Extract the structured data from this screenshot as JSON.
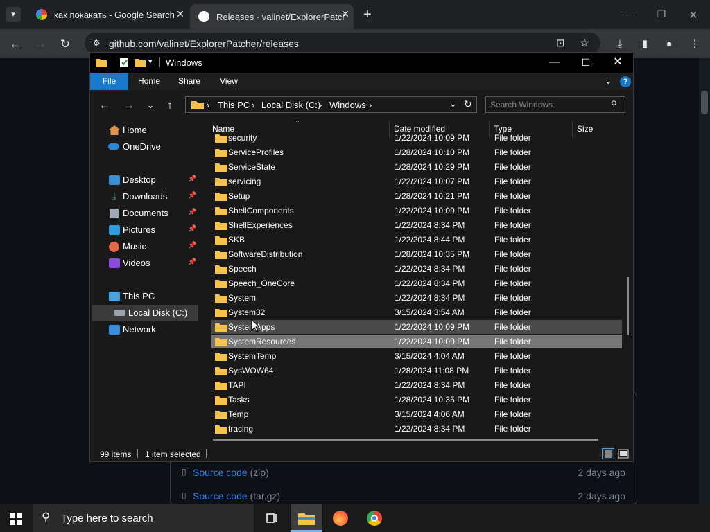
{
  "browser": {
    "tabs": [
      {
        "title": "как покакать - Google Search",
        "active": false
      },
      {
        "title": "Releases · valinet/ExplorerPatcher",
        "active": true
      }
    ],
    "url": "github.com/valinet/ExplorerPatcher/releases"
  },
  "github": {
    "assets": [
      {
        "name": "Source code",
        "ext": "(zip)",
        "time": "2 days ago"
      },
      {
        "name": "Source code",
        "ext": "(tar.gz)",
        "time": "2 days ago"
      }
    ]
  },
  "explorer": {
    "title": "Windows",
    "ribbon_tabs": [
      "File",
      "Home",
      "Share",
      "View"
    ],
    "breadcrumb": [
      "This PC",
      "Local Disk (C:)",
      "Windows"
    ],
    "search_placeholder": "Search Windows",
    "columns": [
      "Name",
      "Date modified",
      "Type",
      "Size"
    ],
    "nav": {
      "home": "Home",
      "onedrive": "OneDrive",
      "quick_access": [
        {
          "label": "Desktop",
          "pinned": true,
          "color": "#3b8fd6"
        },
        {
          "label": "Downloads",
          "pinned": true,
          "color": "#4aa36b"
        },
        {
          "label": "Documents",
          "pinned": true,
          "color": "#a0a8b8"
        },
        {
          "label": "Pictures",
          "pinned": true,
          "color": "#2f9be0"
        },
        {
          "label": "Music",
          "pinned": true,
          "color": "#e26a4a"
        },
        {
          "label": "Videos",
          "pinned": true,
          "color": "#8a4fd6"
        }
      ],
      "this_pc": "This PC",
      "local_disk": "Local Disk (C:)",
      "network": "Network"
    },
    "files": [
      {
        "name": "security",
        "date": "1/22/2024 10:09 PM",
        "type": "File folder"
      },
      {
        "name": "ServiceProfiles",
        "date": "1/28/2024 10:10 PM",
        "type": "File folder"
      },
      {
        "name": "ServiceState",
        "date": "1/28/2024 10:29 PM",
        "type": "File folder"
      },
      {
        "name": "servicing",
        "date": "1/22/2024 10:07 PM",
        "type": "File folder"
      },
      {
        "name": "Setup",
        "date": "1/28/2024 10:21 PM",
        "type": "File folder"
      },
      {
        "name": "ShellComponents",
        "date": "1/22/2024 10:09 PM",
        "type": "File folder"
      },
      {
        "name": "ShellExperiences",
        "date": "1/22/2024 8:34 PM",
        "type": "File folder"
      },
      {
        "name": "SKB",
        "date": "1/22/2024 8:44 PM",
        "type": "File folder"
      },
      {
        "name": "SoftwareDistribution",
        "date": "1/28/2024 10:35 PM",
        "type": "File folder"
      },
      {
        "name": "Speech",
        "date": "1/22/2024 8:34 PM",
        "type": "File folder"
      },
      {
        "name": "Speech_OneCore",
        "date": "1/22/2024 8:34 PM",
        "type": "File folder"
      },
      {
        "name": "System",
        "date": "1/22/2024 8:34 PM",
        "type": "File folder"
      },
      {
        "name": "System32",
        "date": "3/15/2024 3:54 AM",
        "type": "File folder"
      },
      {
        "name": "SystemApps",
        "date": "1/22/2024 10:09 PM",
        "type": "File folder",
        "state": "hover"
      },
      {
        "name": "SystemResources",
        "date": "1/22/2024 10:09 PM",
        "type": "File folder",
        "state": "selected"
      },
      {
        "name": "SystemTemp",
        "date": "3/15/2024 4:04 AM",
        "type": "File folder"
      },
      {
        "name": "SysWOW64",
        "date": "1/28/2024 11:08 PM",
        "type": "File folder"
      },
      {
        "name": "TAPI",
        "date": "1/22/2024 8:34 PM",
        "type": "File folder"
      },
      {
        "name": "Tasks",
        "date": "1/28/2024 10:35 PM",
        "type": "File folder"
      },
      {
        "name": "Temp",
        "date": "3/15/2024 4:06 AM",
        "type": "File folder"
      },
      {
        "name": "tracing",
        "date": "1/22/2024 8:34 PM",
        "type": "File folder"
      }
    ],
    "status": {
      "items": "99 items",
      "selected": "1 item selected"
    }
  },
  "taskbar": {
    "search_placeholder": "Type here to search"
  },
  "colors": {
    "accent": "#1979ca",
    "folder": "#f4c34f",
    "selection": "#777777",
    "link": "#2f81f7"
  }
}
